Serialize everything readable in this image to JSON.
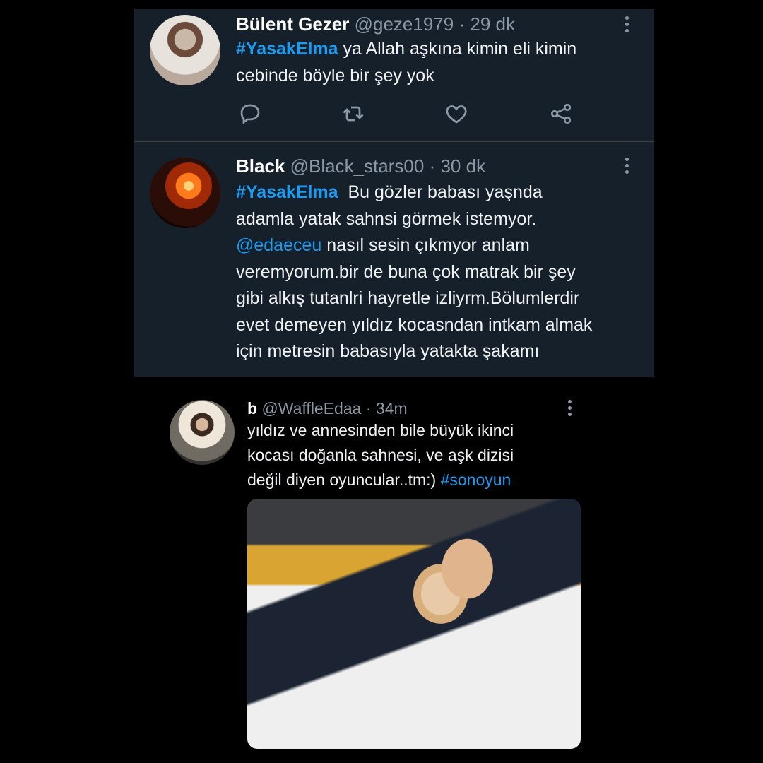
{
  "tweets": [
    {
      "name": "Bülent Gezer",
      "handle": "@geze1979",
      "sep": "·",
      "time": "29 dk",
      "hashtag": "#YasakElma",
      "line1_rest": " ya Allah aşkına kimin eli kimin",
      "line2": "cebinde böyle bir şey yok"
    },
    {
      "name": "Black",
      "handle": "@Black_stars00",
      "sep": "·",
      "time": "30 dk",
      "hashtag": "#YasakElma",
      "line1_rest": "  Bu gözler babası yaşnda",
      "line2": "adamla yatak sahnsi görmek istemyor.",
      "mention": "@edaeceu",
      "line3_rest": " nasıl sesin çıkmyor anlam",
      "line4": "veremyorum.bir de buna çok matrak bir şey",
      "line5": "gibi alkış tutanlri hayretle izliyrm.Bölumlerdir",
      "line6": "evet demeyen yıldız kocasndan intkam almak",
      "line7": "için metresin babasıyla yatakta şakamı"
    },
    {
      "name": "b",
      "handle": "@WaffleEdaa",
      "sep": "·",
      "time": "34m",
      "line1": "yıldız ve annesinden bile büyük ikinci",
      "line2": "kocası doğanla sahnesi, ve aşk dizisi",
      "line3_start": "değil diyen oyuncular..tm:) ",
      "hashtag": "#sonoyun"
    }
  ],
  "icons": {
    "reply": "speech-bubble-icon",
    "retweet": "retweet-icon",
    "like": "heart-icon",
    "share": "share-icon",
    "more": "more-vertical-icon"
  },
  "colors": {
    "background": "#000000",
    "card": "#15202b",
    "link": "#1d9bf0",
    "muted": "#8b98a5"
  }
}
